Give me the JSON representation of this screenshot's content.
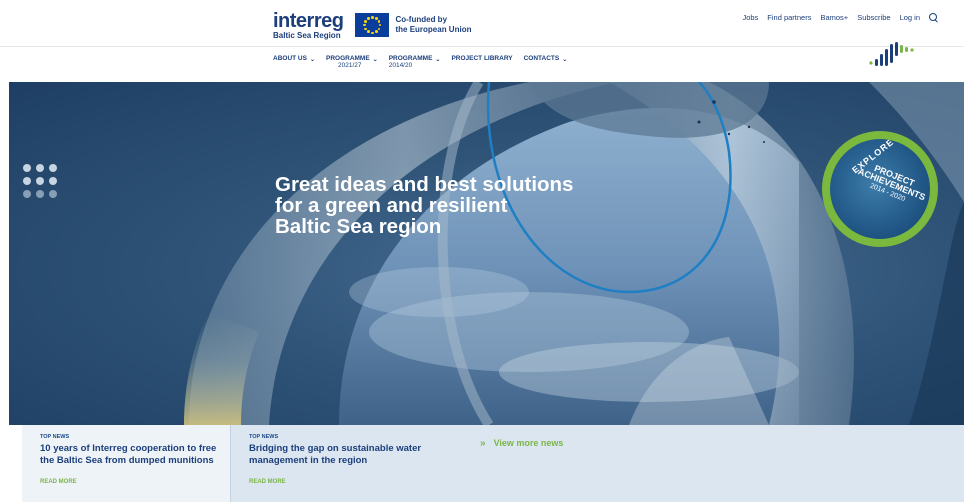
{
  "brand": {
    "logo_word": "interreg",
    "logo_sub": "Baltic Sea Region",
    "cofund_line1": "Co-funded by",
    "cofund_line2": "the European Union"
  },
  "utility_links": [
    "Jobs",
    "Find partners",
    "Bamos+",
    "Subscribe",
    "Log in"
  ],
  "nav": {
    "about": "ABOUT US",
    "prog2127_a": "PROGRAMME",
    "prog2127_b": "2021/27",
    "prog1420_a": "PROGRAMME",
    "prog1420_b": "2014/20",
    "library": "PROJECT LIBRARY",
    "contacts": "CONTACTS"
  },
  "hero": {
    "line1": "Great ideas and best solutions",
    "line2": "for a green and resilient",
    "line3": "Baltic Sea region"
  },
  "badge": {
    "explore": "EXPLORE",
    "line1": "PROJECT",
    "line2": "ACHIEVEMENTS",
    "years": "2014 - 2020"
  },
  "news": [
    {
      "tag": "TOP NEWS",
      "title": "10 years of Interreg cooperation to free the Baltic Sea from dumped munitions",
      "read_more": "READ MORE"
    },
    {
      "tag": "TOP NEWS",
      "title": "Bridging the gap on sustainable water management in the region",
      "read_more": "READ MORE"
    }
  ],
  "view_more": "View more news",
  "colors": {
    "brand_blue": "#1c3f7c",
    "accent_green": "#7ab648",
    "hero_blue": "#2f5478",
    "eu_blue": "#0b3e9a"
  }
}
